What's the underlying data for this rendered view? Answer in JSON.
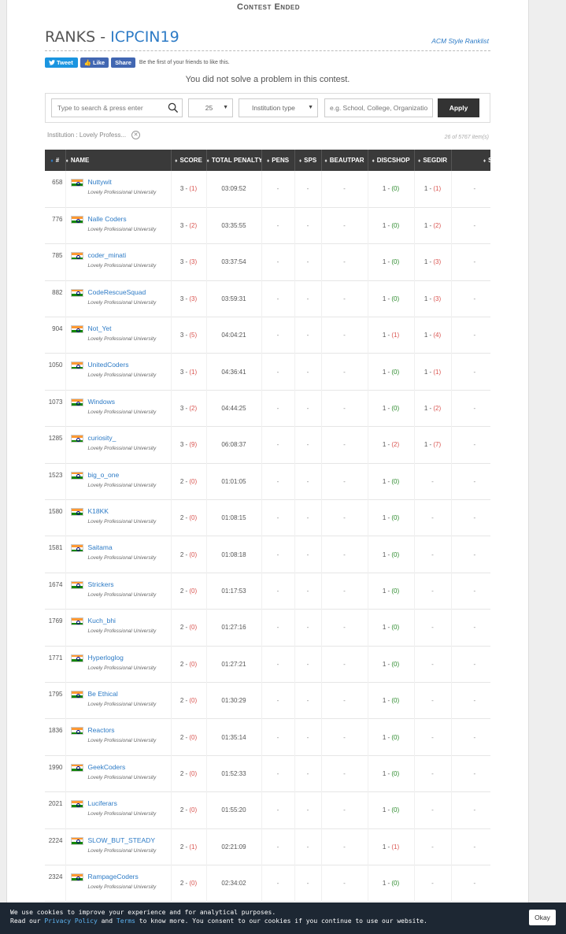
{
  "header": {
    "contest_status": "Contest Ended",
    "ranks_prefix": "RANKS - ",
    "contest_code": "ICPCIN19",
    "ranklist_link": "ACM Style Ranklist"
  },
  "social": {
    "tweet_label": "Tweet",
    "like_label": "Like",
    "share_label": "Share",
    "friends_text": "Be the first of your friends to like this."
  },
  "notice": "You did not solve a problem in this contest.",
  "filters": {
    "search_placeholder": "Type to search & press enter",
    "page_size": "25",
    "institution_type": "Institution type",
    "institution_placeholder": "e.g. School, College, Organizatio",
    "apply_label": "Apply",
    "active_filter": "Institution : Lovely Profess...",
    "item_count": "26 of 5767 item(s)"
  },
  "table": {
    "columns": [
      "#",
      "NAME",
      "SCORE",
      "TOTAL PENALTY",
      "PENS",
      "SPS",
      "BEAUTPAR",
      "DISCSHOP",
      "SEGDIR",
      "SHUFGRI"
    ],
    "rows": [
      {
        "rank": "658",
        "team": "Nuttywit",
        "uni": "Lovely Professional University",
        "score": "3",
        "score_pen": "(1)",
        "penalty": "03:09:52",
        "pens": "-",
        "sps": "-",
        "beautpar": "-",
        "disc": "1",
        "disc_pen": "(0)",
        "seg": "1",
        "seg_pen": "(1)",
        "shuf": "-"
      },
      {
        "rank": "776",
        "team": "Nalle Coders",
        "uni": "Lovely Professional University",
        "score": "3",
        "score_pen": "(2)",
        "penalty": "03:35:55",
        "pens": "-",
        "sps": "-",
        "beautpar": "-",
        "disc": "1",
        "disc_pen": "(0)",
        "seg": "1",
        "seg_pen": "(2)",
        "shuf": "-"
      },
      {
        "rank": "785",
        "team": "coder_minati",
        "uni": "Lovely Professional University",
        "score": "3",
        "score_pen": "(3)",
        "penalty": "03:37:54",
        "pens": "-",
        "sps": "-",
        "beautpar": "-",
        "disc": "1",
        "disc_pen": "(0)",
        "seg": "1",
        "seg_pen": "(3)",
        "shuf": "-"
      },
      {
        "rank": "882",
        "team": "CodeRescueSquad",
        "uni": "Lovely Professional University",
        "score": "3",
        "score_pen": "(3)",
        "penalty": "03:59:31",
        "pens": "-",
        "sps": "-",
        "beautpar": "-",
        "disc": "1",
        "disc_pen": "(0)",
        "seg": "1",
        "seg_pen": "(3)",
        "shuf": "-"
      },
      {
        "rank": "904",
        "team": "Not_Yet",
        "uni": "Lovely Professional University",
        "score": "3",
        "score_pen": "(5)",
        "penalty": "04:04:21",
        "pens": "-",
        "sps": "-",
        "beautpar": "-",
        "disc": "1",
        "disc_pen": "(1)",
        "seg": "1",
        "seg_pen": "(4)",
        "shuf": "-"
      },
      {
        "rank": "1050",
        "team": "UnitedCoders",
        "uni": "Lovely Professional University",
        "score": "3",
        "score_pen": "(1)",
        "penalty": "04:36:41",
        "pens": "-",
        "sps": "-",
        "beautpar": "-",
        "disc": "1",
        "disc_pen": "(0)",
        "seg": "1",
        "seg_pen": "(1)",
        "shuf": "-"
      },
      {
        "rank": "1073",
        "team": "Windows",
        "uni": "Lovely Professional University",
        "score": "3",
        "score_pen": "(2)",
        "penalty": "04:44:25",
        "pens": "-",
        "sps": "-",
        "beautpar": "-",
        "disc": "1",
        "disc_pen": "(0)",
        "seg": "1",
        "seg_pen": "(2)",
        "shuf": "-"
      },
      {
        "rank": "1285",
        "team": "curiosity_",
        "uni": "Lovely Professional University",
        "score": "3",
        "score_pen": "(9)",
        "penalty": "06:08:37",
        "pens": "-",
        "sps": "-",
        "beautpar": "-",
        "disc": "1",
        "disc_pen": "(2)",
        "seg": "1",
        "seg_pen": "(7)",
        "shuf": "-"
      },
      {
        "rank": "1523",
        "team": "big_o_one",
        "uni": "Lovely Professional University",
        "score": "2",
        "score_pen": "(0)",
        "penalty": "01:01:05",
        "pens": "-",
        "sps": "-",
        "beautpar": "-",
        "disc": "1",
        "disc_pen": "(0)",
        "seg": "",
        "seg_pen": "",
        "shuf": "-"
      },
      {
        "rank": "1580",
        "team": "K18KK",
        "uni": "Lovely Professional University",
        "score": "2",
        "score_pen": "(0)",
        "penalty": "01:08:15",
        "pens": "-",
        "sps": "-",
        "beautpar": "-",
        "disc": "1",
        "disc_pen": "(0)",
        "seg": "",
        "seg_pen": "",
        "shuf": "-"
      },
      {
        "rank": "1581",
        "team": "Saitama",
        "uni": "Lovely Professional University",
        "score": "2",
        "score_pen": "(0)",
        "penalty": "01:08:18",
        "pens": "-",
        "sps": "-",
        "beautpar": "-",
        "disc": "1",
        "disc_pen": "(0)",
        "seg": "",
        "seg_pen": "",
        "shuf": "-"
      },
      {
        "rank": "1674",
        "team": "Strickers",
        "uni": "Lovely Professional University",
        "score": "2",
        "score_pen": "(0)",
        "penalty": "01:17:53",
        "pens": "-",
        "sps": "-",
        "beautpar": "-",
        "disc": "1",
        "disc_pen": "(0)",
        "seg": "",
        "seg_pen": "",
        "shuf": "-"
      },
      {
        "rank": "1769",
        "team": "Kuch_bhi",
        "uni": "Lovely Professional University",
        "score": "2",
        "score_pen": "(0)",
        "penalty": "01:27:16",
        "pens": "-",
        "sps": "-",
        "beautpar": "-",
        "disc": "1",
        "disc_pen": "(0)",
        "seg": "",
        "seg_pen": "",
        "shuf": "-"
      },
      {
        "rank": "1771",
        "team": "Hyperloglog",
        "uni": "Lovely Professional University",
        "score": "2",
        "score_pen": "(0)",
        "penalty": "01:27:21",
        "pens": "-",
        "sps": "-",
        "beautpar": "-",
        "disc": "1",
        "disc_pen": "(0)",
        "seg": "",
        "seg_pen": "",
        "shuf": "-"
      },
      {
        "rank": "1795",
        "team": "Be Ethical",
        "uni": "Lovely Professional University",
        "score": "2",
        "score_pen": "(0)",
        "penalty": "01:30:29",
        "pens": "-",
        "sps": "-",
        "beautpar": "-",
        "disc": "1",
        "disc_pen": "(0)",
        "seg": "",
        "seg_pen": "",
        "shuf": "-"
      },
      {
        "rank": "1836",
        "team": "Reactors",
        "uni": "Lovely Professional University",
        "score": "2",
        "score_pen": "(0)",
        "penalty": "01:35:14",
        "pens": "-",
        "sps": "-",
        "beautpar": "-",
        "disc": "1",
        "disc_pen": "(0)",
        "seg": "",
        "seg_pen": "",
        "shuf": "-"
      },
      {
        "rank": "1990",
        "team": "GeekCoders",
        "uni": "Lovely Professional University",
        "score": "2",
        "score_pen": "(0)",
        "penalty": "01:52:33",
        "pens": "-",
        "sps": "-",
        "beautpar": "-",
        "disc": "1",
        "disc_pen": "(0)",
        "seg": "",
        "seg_pen": "",
        "shuf": "-"
      },
      {
        "rank": "2021",
        "team": "Luciferars",
        "uni": "Lovely Professional University",
        "score": "2",
        "score_pen": "(0)",
        "penalty": "01:55:20",
        "pens": "-",
        "sps": "-",
        "beautpar": "-",
        "disc": "1",
        "disc_pen": "(0)",
        "seg": "",
        "seg_pen": "",
        "shuf": "-"
      },
      {
        "rank": "2224",
        "team": "SLOW_BUT_STEADY",
        "uni": "Lovely Professional University",
        "score": "2",
        "score_pen": "(1)",
        "penalty": "02:21:09",
        "pens": "-",
        "sps": "-",
        "beautpar": "-",
        "disc": "1",
        "disc_pen": "(1)",
        "seg": "",
        "seg_pen": "",
        "shuf": "-"
      },
      {
        "rank": "2324",
        "team": "RampageCoders",
        "uni": "Lovely Professional University",
        "score": "2",
        "score_pen": "(0)",
        "penalty": "02:34:02",
        "pens": "-",
        "sps": "-",
        "beautpar": "-",
        "disc": "1",
        "disc_pen": "(0)",
        "seg": "",
        "seg_pen": "",
        "shuf": "-"
      }
    ]
  },
  "cookie": {
    "line1": "We use cookies to improve your experience and for analytical purposes.",
    "read_prefix": "Read our ",
    "privacy_label": "Privacy Policy",
    "and_text": " and ",
    "terms_label": "Terms",
    "line2_suffix": " to know more. You consent to our cookies if you continue to use our website.",
    "okay_label": "Okay"
  },
  "colors": {
    "accent": "#2d7bc6",
    "header_bg": "#3a3a3a",
    "penalty_red": "#d9534f",
    "penalty_green": "#2b8a2b",
    "cookie_bg": "#1d2733"
  }
}
